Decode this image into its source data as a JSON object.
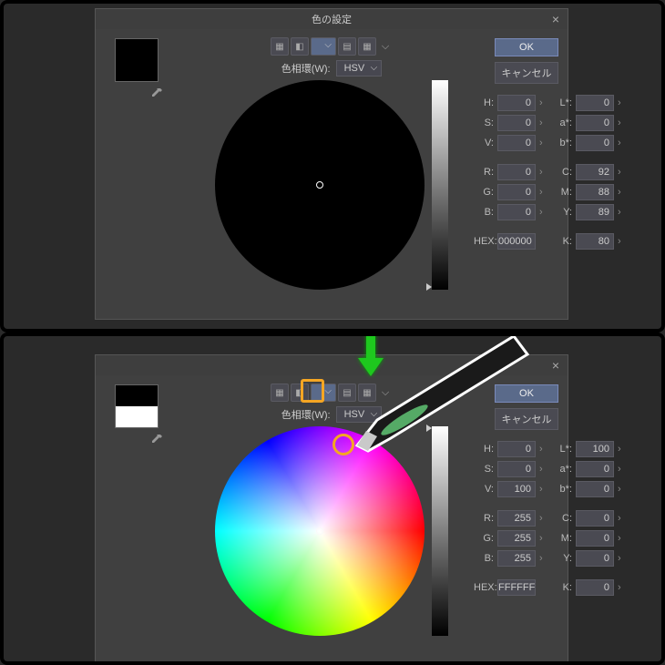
{
  "dialog": {
    "title": "色の設定",
    "close_tip": "×",
    "ok_label": "OK",
    "cancel_label": "キャンセル",
    "wheel_label": "色相環(W):",
    "wheel_mode": "HSV",
    "hex_label": "HEX:"
  },
  "top": {
    "swatch_color": "#000000",
    "slider_pos": "bottom",
    "fields": {
      "H": "0",
      "S": "0",
      "V": "0",
      "R": "0",
      "G": "0",
      "B": "0",
      "HEX": "000000",
      "L": "0",
      "a": "0",
      "b": "0",
      "C": "92",
      "M": "88",
      "Y": "89",
      "K": "80"
    },
    "labels": {
      "H": "H:",
      "S": "S:",
      "V": "V:",
      "R": "R:",
      "G": "G:",
      "B": "B:",
      "L": "L*:",
      "a": "a*:",
      "b": "b*:",
      "C": "C:",
      "M": "M:",
      "Y": "Y:",
      "K": "K:"
    }
  },
  "bottom": {
    "swatch_color": "half",
    "slider_pos": "top",
    "fields": {
      "H": "0",
      "S": "0",
      "V": "100",
      "R": "255",
      "G": "255",
      "B": "255",
      "HEX": "FFFFFF",
      "L": "100",
      "a": "0",
      "b": "0",
      "C": "0",
      "M": "0",
      "Y": "0",
      "K": "0"
    },
    "labels": {
      "H": "H:",
      "S": "S:",
      "V": "V:",
      "R": "R:",
      "G": "G:",
      "B": "B:",
      "L": "L*:",
      "a": "a*:",
      "b": "b*:",
      "C": "C:",
      "M": "M:",
      "Y": "Y:",
      "K": "K:"
    }
  }
}
